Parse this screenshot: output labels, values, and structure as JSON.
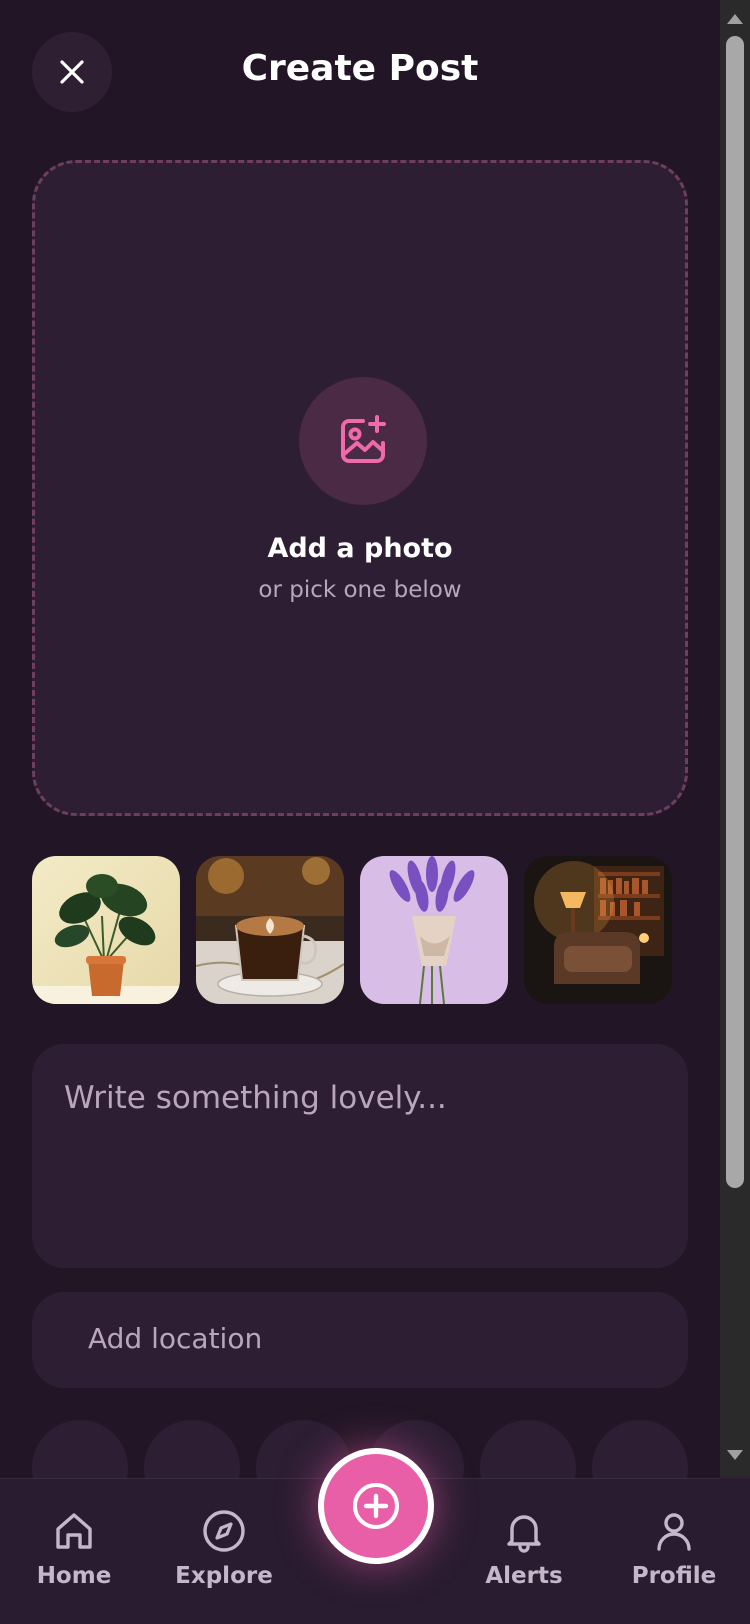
{
  "header": {
    "title": "Create Post",
    "close_icon": "close-icon"
  },
  "upload": {
    "icon": "image-plus-icon",
    "title": "Add a photo",
    "subtitle": "or pick one below"
  },
  "suggestions": [
    {
      "name": "monstera-plant-photo",
      "subject": "potted monstera plant"
    },
    {
      "name": "latte-art-photo",
      "subject": "latte in glass cup"
    },
    {
      "name": "lavender-bouquet-photo",
      "subject": "lavender bouquet"
    },
    {
      "name": "cozy-reading-nook-photo",
      "subject": "armchair with lamp and bookshelves"
    }
  ],
  "caption": {
    "placeholder": "Write something lovely..."
  },
  "location": {
    "placeholder": "Add location"
  },
  "nav": {
    "items": [
      {
        "label": "Home",
        "icon": "home-icon"
      },
      {
        "label": "Explore",
        "icon": "compass-icon"
      },
      {
        "label": "Alerts",
        "icon": "bell-icon"
      },
      {
        "label": "Profile",
        "icon": "user-icon"
      }
    ],
    "fab_icon": "plus-circle-icon"
  },
  "colors": {
    "background": "#221626",
    "surface": "#2d1e33",
    "accent": "#e85fa8",
    "muted_text": "#b9a6bd",
    "dashed_border": "#6e3e5e"
  }
}
